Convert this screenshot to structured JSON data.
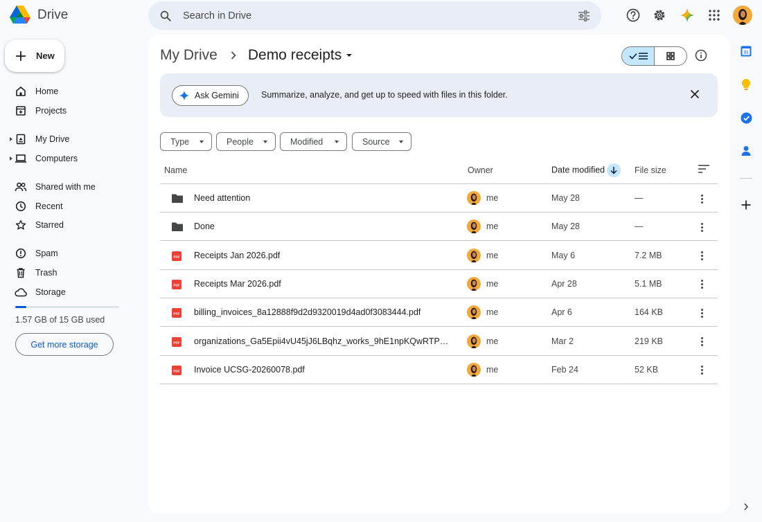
{
  "app": {
    "name": "Drive"
  },
  "search": {
    "placeholder": "Search in Drive"
  },
  "sidebar": {
    "new_label": "New",
    "items": [
      {
        "label": "Home",
        "icon": "home-icon"
      },
      {
        "label": "Projects",
        "icon": "projects-icon"
      },
      {
        "label": "My Drive",
        "icon": "my-drive-icon"
      },
      {
        "label": "Computers",
        "icon": "computers-icon"
      },
      {
        "label": "Shared with me",
        "icon": "shared-icon"
      },
      {
        "label": "Recent",
        "icon": "clock-icon"
      },
      {
        "label": "Starred",
        "icon": "star-icon"
      },
      {
        "label": "Spam",
        "icon": "spam-icon"
      },
      {
        "label": "Trash",
        "icon": "trash-icon"
      },
      {
        "label": "Storage",
        "icon": "cloud-icon"
      }
    ],
    "storage_text": "1.57 GB of 15 GB used",
    "storage_fraction": 0.105,
    "storage_button": "Get more storage"
  },
  "breadcrumb": {
    "root": "My Drive",
    "current": "Demo receipts"
  },
  "gemini": {
    "button": "Ask Gemini",
    "text": "Summarize, analyze, and get up to speed with files in this folder."
  },
  "filters": [
    "Type",
    "People",
    "Modified",
    "Source"
  ],
  "table": {
    "headers": {
      "name": "Name",
      "owner": "Owner",
      "date": "Date modified",
      "size": "File size"
    },
    "rows": [
      {
        "type": "folder",
        "name": "Need attention",
        "owner": "me",
        "date": "May 28",
        "size": "—"
      },
      {
        "type": "folder",
        "name": "Done",
        "owner": "me",
        "date": "May 28",
        "size": "—"
      },
      {
        "type": "pdf",
        "name": "Receipts Jan 2026.pdf",
        "owner": "me",
        "date": "May 6",
        "size": "7.2 MB"
      },
      {
        "type": "pdf",
        "name": "Receipts Mar 2026.pdf",
        "owner": "me",
        "date": "Apr 28",
        "size": "5.1 MB"
      },
      {
        "type": "pdf",
        "name": "billing_invoices_8a12888f9d2d9320019d4ad0f3083444.pdf",
        "owner": "me",
        "date": "Apr 6",
        "size": "164 KB"
      },
      {
        "type": "pdf",
        "name": "organizations_Ga5Epii4vU45jJ6LBqhz_works_9hE1npKQwRTPw...",
        "owner": "me",
        "date": "Mar 2",
        "size": "219 KB"
      },
      {
        "type": "pdf",
        "name": "Invoice UCSG-20260078.pdf",
        "owner": "me",
        "date": "Feb 24",
        "size": "52 KB"
      }
    ]
  },
  "colors": {
    "accent": "#0b57d0",
    "selected": "#c2e7ff",
    "pdf": "#ea4335",
    "folder": "#444746"
  }
}
